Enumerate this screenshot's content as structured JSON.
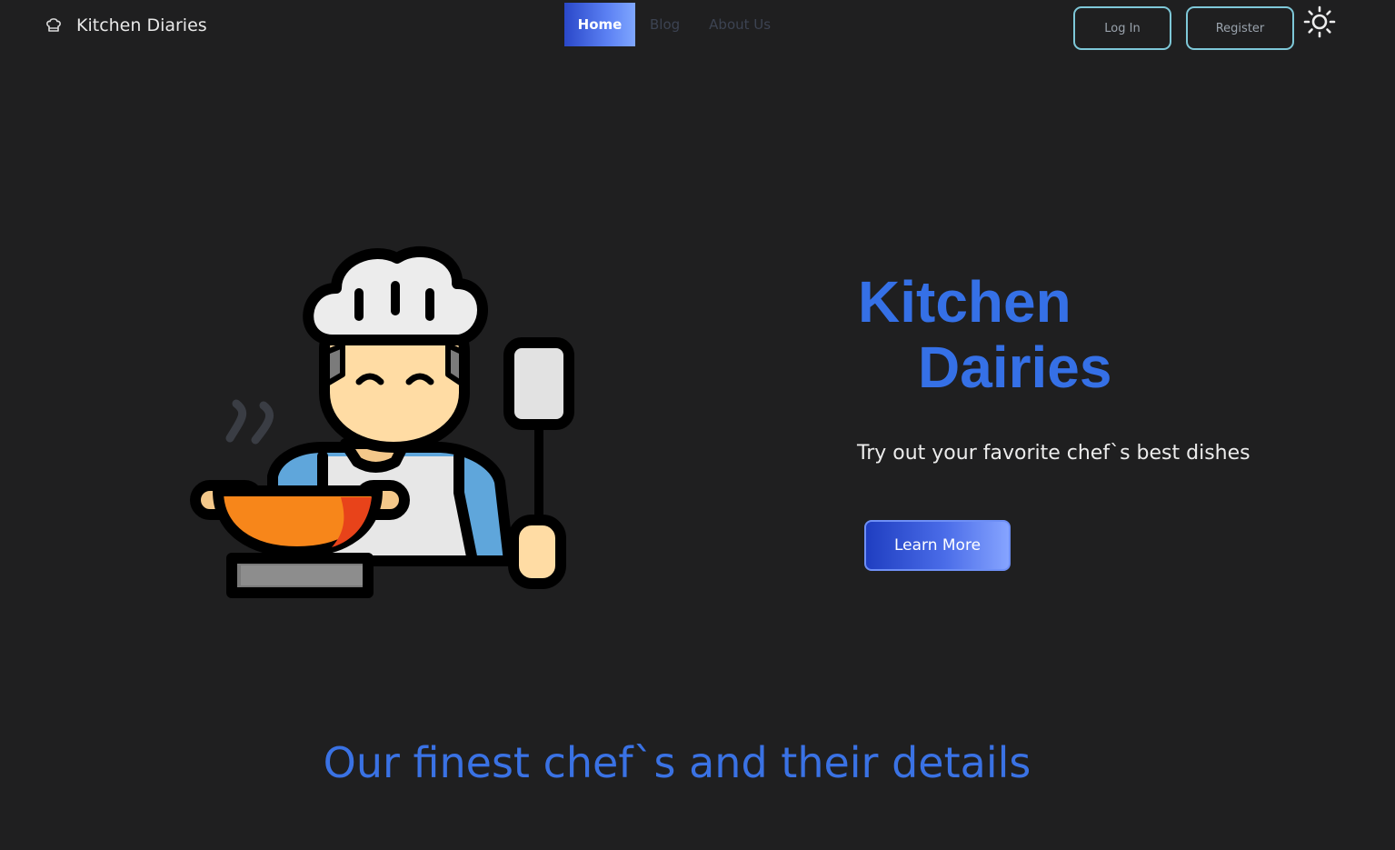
{
  "brand": {
    "name": "Kitchen Diaries",
    "icon": "chef-hat-icon"
  },
  "nav": {
    "items": [
      {
        "label": "Home",
        "active": true
      },
      {
        "label": "Blog",
        "active": false
      },
      {
        "label": "About Us",
        "active": false
      }
    ]
  },
  "auth": {
    "login_label": "Log In",
    "register_label": "Register"
  },
  "theme_toggle": {
    "icon": "sun-icon"
  },
  "hero": {
    "title_line1": "Kitchen",
    "title_line2": "Dairies",
    "subtitle": "Try out your favorite chef`s best dishes",
    "cta_label": "Learn More",
    "illustration": "chef-cooking-illustration"
  },
  "section": {
    "heading": "Our finest chef`s and their details"
  },
  "colors": {
    "background": "#1f1f20",
    "accent_blue": "#3570e6",
    "button_border": "#7ec8d8",
    "gradient_start": "#1f3ec1",
    "gradient_end": "#86a4ff"
  }
}
